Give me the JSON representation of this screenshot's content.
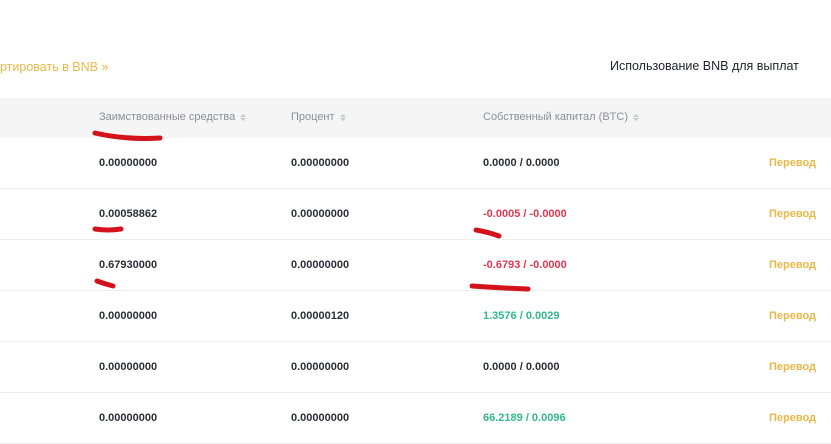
{
  "header": {
    "convert_link": "ртировать в BNB »",
    "bnb_usage_text": "Использование BNB для выплат"
  },
  "table": {
    "columns": {
      "borrowed": "Заимствованные средства",
      "interest": "Процент",
      "equity": "Собственный капитал (BTC)"
    },
    "rows": [
      {
        "borrowed": "0.00000000",
        "interest": "0.00000000",
        "equity": "0.0000 / 0.0000",
        "status": "neutral",
        "action": "Перевод"
      },
      {
        "borrowed": "0.00058862",
        "interest": "0.00000000",
        "equity": "-0.0005 / -0.0000",
        "status": "negative",
        "action": "Перевод"
      },
      {
        "borrowed": "0.67930000",
        "interest": "0.00000000",
        "equity": "-0.6793 / -0.0000",
        "status": "negative",
        "action": "Перевод"
      },
      {
        "borrowed": "0.00000000",
        "interest": "0.00000120",
        "equity": "1.3576 / 0.0029",
        "status": "positive",
        "action": "Перевод"
      },
      {
        "borrowed": "0.00000000",
        "interest": "0.00000000",
        "equity": "0.0000 / 0.0000",
        "status": "neutral",
        "action": "Перевод"
      },
      {
        "borrowed": "0.00000000",
        "interest": "0.00000000",
        "equity": "66.2189 / 0.0096",
        "status": "positive",
        "action": "Перевод"
      }
    ]
  },
  "colors": {
    "accent": "#e8b84a",
    "negative": "#e0384f",
    "positive": "#31b98a",
    "annotation_marker": "#d4121b"
  },
  "icons": [
    "sort-icon"
  ]
}
